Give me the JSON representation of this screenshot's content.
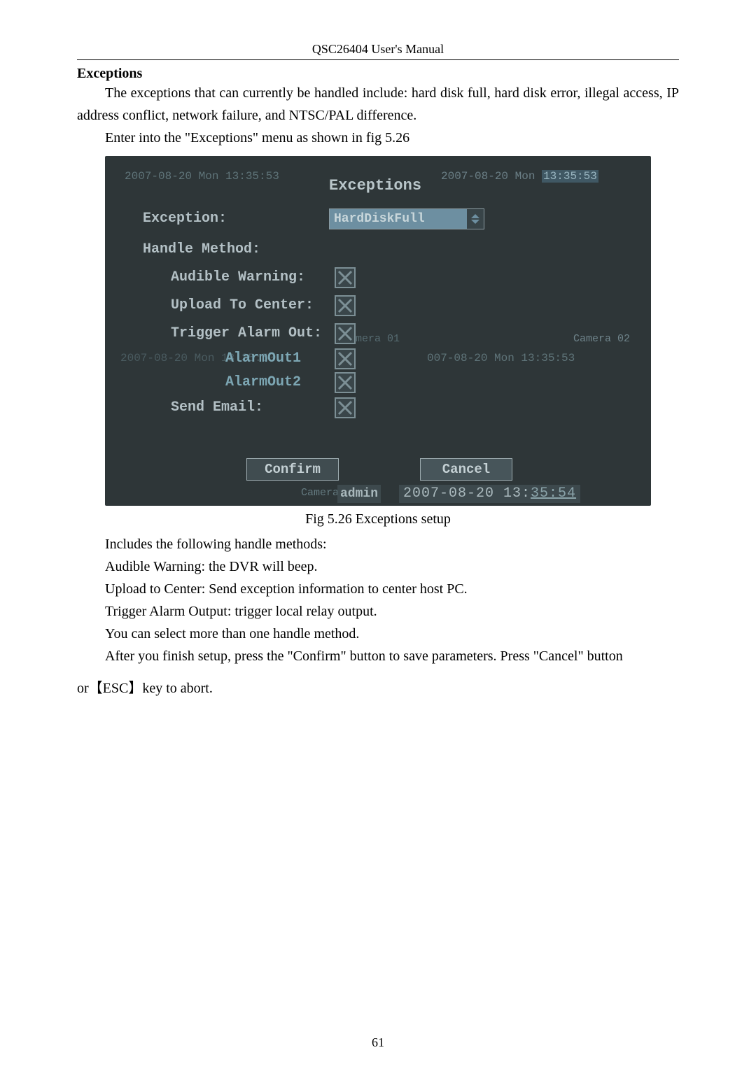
{
  "header": "QSC26404 User's Manual",
  "section_title": "Exceptions",
  "para1": "The exceptions that can currently be handled include: hard disk full, hard disk error, illegal access, IP address conflict, network failure, and NTSC/PAL difference.",
  "para2": "Enter into the \"Exceptions\" menu as shown in fig 5.26",
  "fig_caption": "Fig 5.26 Exceptions setup",
  "after1": "Includes the following handle methods:",
  "after2": "Audible Warning: the DVR will beep.",
  "after3": "Upload to Center: Send exception information to center host PC.",
  "after4": "Trigger Alarm Output: trigger local relay output.",
  "after5": "You can select more than one handle method.",
  "after6": "After you finish setup, press the \"Confirm\" button to save parameters. Press \"Cancel\" button",
  "after7": "or【ESC】key to abort.",
  "page_num": "61",
  "shot": {
    "ts_tl": "2007-08-20 Mon 13:35:53",
    "ts_tr_a": "2007-08-20 Mon ",
    "ts_tr_b": "13:35:53",
    "ts_ml": "2007-08-20 Mon 13:35:53",
    "ts_mr": "007-08-20 Mon 13:35:53",
    "cam01": "Camera 01",
    "cam02": "Camera 02",
    "cam03": "Camera 03",
    "title": "Exceptions",
    "labels": {
      "exception": "Exception:",
      "handle": "Handle Method:",
      "audible": "Audible Warning:",
      "upload": "Upload To Center:",
      "trigger": "Trigger Alarm Out:",
      "ao1": "AlarmOut1",
      "ao2": "AlarmOut2",
      "email": "Send Email:"
    },
    "dropdown_value": "HardDiskFull",
    "confirm": "Confirm",
    "cancel": "Cancel",
    "user": "admin",
    "footer_date": "2007-08-20 13:",
    "footer_mm": "35:",
    "footer_ss": "54"
  }
}
